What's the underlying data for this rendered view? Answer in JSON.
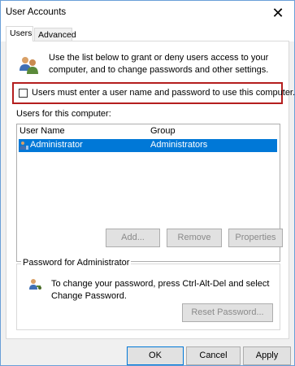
{
  "window": {
    "title": "User Accounts"
  },
  "tabs": [
    {
      "label": "Users",
      "active": true
    },
    {
      "label": "Advanced",
      "active": false
    }
  ],
  "intro": {
    "text": "Use the list below to grant or deny users access to your computer, and to change passwords and other settings."
  },
  "require_login": {
    "label": "Users must enter a user name and password to use this computer.",
    "checked": false
  },
  "users_section": {
    "label": "Users for this computer:",
    "columns": [
      "User Name",
      "Group"
    ],
    "rows": [
      {
        "user_name": "Administrator",
        "group": "Administrators",
        "selected": true
      }
    ]
  },
  "user_buttons": {
    "add": "Add...",
    "remove": "Remove",
    "properties": "Properties"
  },
  "password_group": {
    "legend": "Password for Administrator",
    "text": "To change your password, press Ctrl-Alt-Del and select Change Password.",
    "reset_button": "Reset Password..."
  },
  "dialog_buttons": {
    "ok": "OK",
    "cancel": "Cancel",
    "apply": "Apply"
  },
  "colors": {
    "selection": "#0078d7",
    "highlight_border": "#b41e1e",
    "window_border": "#6a9fd8"
  },
  "icons": {
    "users_icon": "users-group-icon",
    "row_icon": "user-icon",
    "password_icon": "key-user-icon",
    "close_icon": "close-icon"
  }
}
